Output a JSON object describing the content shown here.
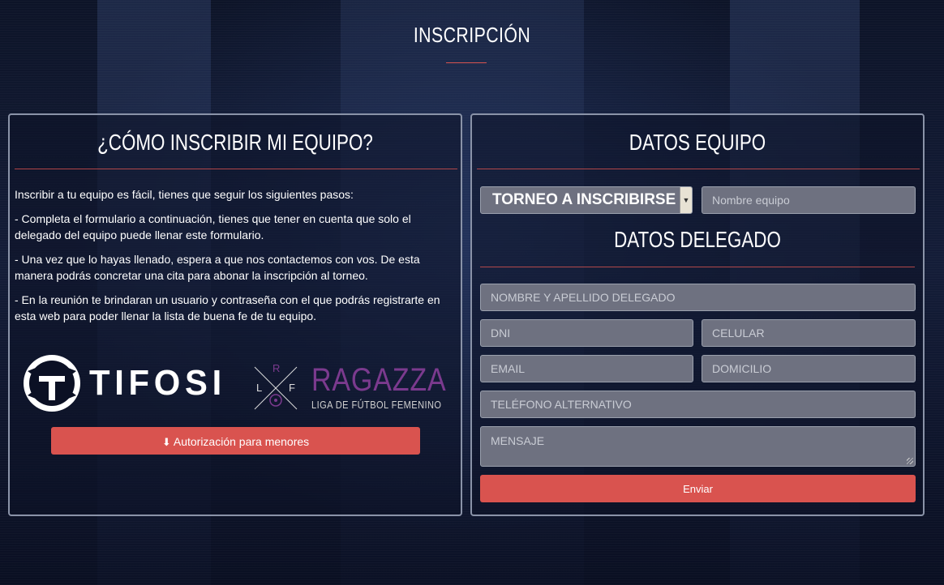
{
  "page": {
    "heading": "INSCRIPCIÓN"
  },
  "left_panel": {
    "title": "¿CÓMO INSCRIBIR MI EQUIPO?",
    "intro": "Inscribir a tu equipo es fácil, tienes que seguir los siguientes pasos:",
    "step1": "- Completa el formulario a continuación, tienes que tener en cuenta que solo el delegado del equipo puede llenar este formulario.",
    "step2": "- Una vez que lo hayas llenado, espera a que nos contactemos con vos. De esta manera podrás concretar una cita para abonar la inscripción al torneo.",
    "step3": "- En la reunión te brindaran un usuario y contraseña con el que podrás registrarte en esta web para poder llenar la lista de buena fe de tu equipo.",
    "logos": {
      "tifosi": "TIFOSI",
      "ragazza_monogram": [
        "L",
        "R",
        "F"
      ],
      "ragazza_name": "RAGAZZA",
      "ragazza_tagline": "LIGA DE FÚTBOL FEMENINO"
    },
    "auth_button": {
      "icon": "download-icon",
      "label": "Autorización para menores"
    }
  },
  "right_panel": {
    "equipo_title": "DATOS EQUIPO",
    "tournament_select": "TORNEO A INSCRIBIRSE",
    "team_name_placeholder": "Nombre equipo",
    "delegado_title": "DATOS DELEGADO",
    "fields": {
      "nombre": "NOMBRE Y APELLIDO DELEGADO",
      "dni": "DNI",
      "celular": "CELULAR",
      "email": "EMAIL",
      "domicilio": "DOMICILIO",
      "telefono": "TELÉFONO ALTERNATIVO",
      "mensaje": "MENSAJE"
    },
    "submit": "Enviar"
  },
  "colors": {
    "accent": "#d9534f",
    "field_bg": "#6e7180",
    "ragazza": "#7b3a8e"
  }
}
